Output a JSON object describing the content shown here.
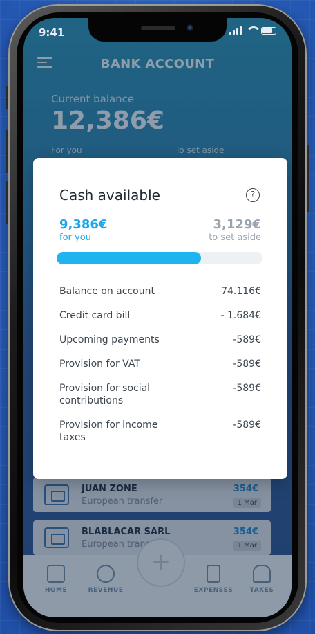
{
  "status_bar": {
    "time": "9:41"
  },
  "header": {
    "title": "BANK ACCOUNT"
  },
  "balance": {
    "label": "Current balance",
    "value": "12,386€",
    "for_you_label": "For you",
    "set_aside_label": "To set aside"
  },
  "modal": {
    "title": "Cash available",
    "help_symbol": "?",
    "for_you_amount": "9,386€",
    "for_you_label": "for you",
    "set_aside_amount": "3,129€",
    "set_aside_label": "to set aside",
    "progress_fraction": 0.7,
    "rows": [
      {
        "label": "Balance on account",
        "value": "74.116€"
      },
      {
        "label": "Credit card bill",
        "value": "- 1.684€"
      },
      {
        "label": "Upcoming payments",
        "value": "-589€"
      },
      {
        "label": "Provision for VAT",
        "value": "-589€"
      },
      {
        "label": "Provision for social contributions",
        "value": "-589€"
      },
      {
        "label": "Provision for income taxes",
        "value": "-589€"
      }
    ]
  },
  "transactions": [
    {
      "name": "JUAN ZONE",
      "type": "European transfer",
      "amount": "354€",
      "date": "1 Mar"
    },
    {
      "name": "BLABLACAR SARL",
      "type": "European transfer",
      "amount": "354€",
      "date": "1 Mar"
    }
  ],
  "nav": {
    "home": "HOME",
    "revenue": "REVENUE",
    "add": "+",
    "expenses": "EXPENSES",
    "taxes": "TAXES"
  },
  "colors": {
    "accent": "#1fb4f0",
    "header_bg": "#2a8fb1",
    "muted": "#9aa4ae"
  }
}
